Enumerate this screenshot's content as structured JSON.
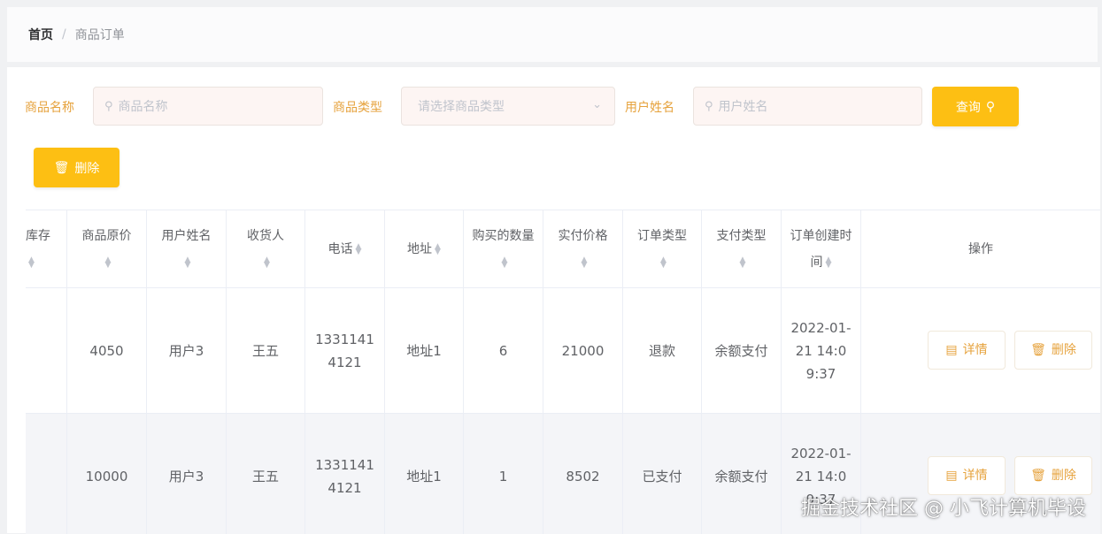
{
  "breadcrumb": {
    "home": "首页",
    "separator": "/",
    "current": "商品订单"
  },
  "filters": {
    "product_name": {
      "label": "商品名称",
      "placeholder": "商品名称",
      "icon": "search-icon"
    },
    "product_type": {
      "label": "商品类型",
      "placeholder": "请选择商品类型",
      "icon": "chevron-down-icon"
    },
    "user_name": {
      "label": "用户姓名",
      "placeholder": "用户姓名",
      "icon": "search-icon"
    },
    "query_button": {
      "label": "查询",
      "icon": "search-icon"
    }
  },
  "toolbar": {
    "delete_button": {
      "label": "删除",
      "icon": "trash-icon"
    }
  },
  "table": {
    "columns": [
      {
        "label": "库存"
      },
      {
        "label": "商品原价"
      },
      {
        "label": "用户姓名"
      },
      {
        "label": "收货人"
      },
      {
        "label": "电话"
      },
      {
        "label": "地址"
      },
      {
        "label": "购买的数量"
      },
      {
        "label": "实付价格"
      },
      {
        "label": "订单类型"
      },
      {
        "label": "支付类型"
      },
      {
        "label": "订单创建时间"
      },
      {
        "label": "操作"
      }
    ],
    "rows": [
      {
        "stock": "",
        "original_price": "4050",
        "user_name": "用户3",
        "receiver": "王五",
        "phone": "13311414121",
        "address": "地址1",
        "quantity": "6",
        "paid_price": "21000",
        "order_type": "退款",
        "payment_type": "余额支付",
        "created_time": "2022-01-21 14:09:37"
      },
      {
        "stock": "",
        "original_price": "10000",
        "user_name": "用户3",
        "receiver": "王五",
        "phone": "13311414121",
        "address": "地址1",
        "quantity": "1",
        "paid_price": "8502",
        "order_type": "已支付",
        "payment_type": "余额支付",
        "created_time": "2022-01-21 14:09:37"
      }
    ],
    "row_actions": {
      "detail": "详情",
      "delete": "删除",
      "detail_icon": "document-icon",
      "delete_icon": "trash-icon"
    }
  },
  "watermark": "掘金技术社区 @ 小飞计算机毕设",
  "colors": {
    "accent": "#fdbf13",
    "label": "#e6a23c",
    "input_bg": "#fdf5f3",
    "row_alt": "#f4f5f8"
  }
}
